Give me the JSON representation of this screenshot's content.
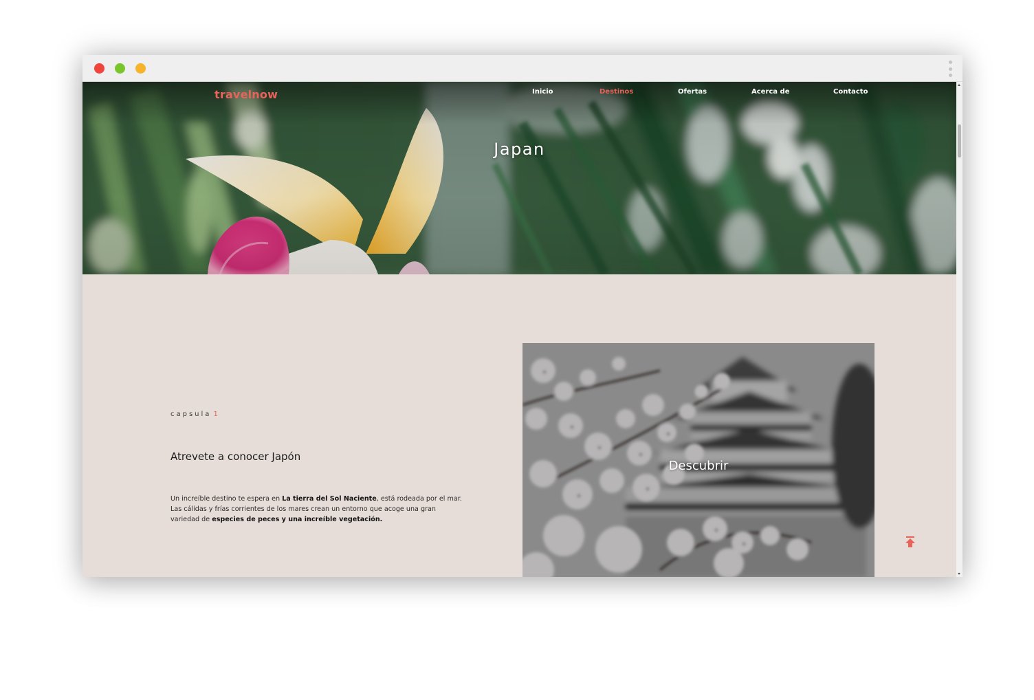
{
  "window": {
    "controls": [
      {
        "name": "close",
        "color": "#f0453d"
      },
      {
        "name": "zoom",
        "color": "#7ac52b"
      },
      {
        "name": "minimize",
        "color": "#f5b42a"
      }
    ]
  },
  "site": {
    "logo": "travelnow",
    "logo_color": "#e8635a"
  },
  "nav": {
    "items": [
      {
        "label": "Inicio",
        "active": false
      },
      {
        "label": "Destinos",
        "active": true
      },
      {
        "label": "Ofertas",
        "active": false
      },
      {
        "label": "Acerca de",
        "active": false
      },
      {
        "label": "Contacto",
        "active": false
      }
    ],
    "active_color": "#e8635a"
  },
  "hero": {
    "title": "Japan"
  },
  "section": {
    "kicker": "capsula",
    "kicker_number": "1",
    "title": "Atrevete a conocer Japón",
    "body": [
      {
        "text": "Un increíble destino te espera en ",
        "bold": false
      },
      {
        "text": "La tierra del Sol Naciente",
        "bold": true
      },
      {
        "text": ", está rodeada por el mar. Las cálidas y frías corrientes de los mares crean un entorno que acoge una gran variedad de ",
        "bold": false
      },
      {
        "text": "especies de peces y una increíble vegetación.",
        "bold": true
      }
    ]
  },
  "card": {
    "label": "Descubrir"
  },
  "back_to_top": {
    "icon": "arrow-to-top-icon",
    "color": "#e8635a"
  }
}
